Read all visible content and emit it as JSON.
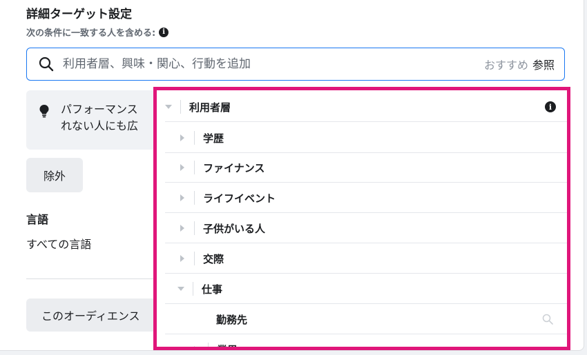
{
  "section": {
    "title": "詳細ターゲット設定",
    "subtitle": "次の条件に一致する人を含める:"
  },
  "search": {
    "placeholder": "利用者層、興味・関心、行動を追加",
    "suggest_label": "おすすめ",
    "browse_label": "参照"
  },
  "tip": {
    "line1": "パフォーマンス",
    "line2": "れない人にも広"
  },
  "exclude_label": "除外",
  "language": {
    "title": "言語",
    "value": "すべての言語"
  },
  "audience_button_label": "このオーディエンス",
  "dropdown": {
    "root_label": "利用者層",
    "items": [
      {
        "label": "学歴"
      },
      {
        "label": "ファイナンス"
      },
      {
        "label": "ライフイベント"
      },
      {
        "label": "子供がいる人"
      },
      {
        "label": "交際"
      },
      {
        "label": "仕事"
      }
    ],
    "subitem_label": "勤務先",
    "next_partial_label": "業界"
  },
  "colors": {
    "highlight_border": "#e0167a",
    "focus_border": "#1877f2"
  }
}
